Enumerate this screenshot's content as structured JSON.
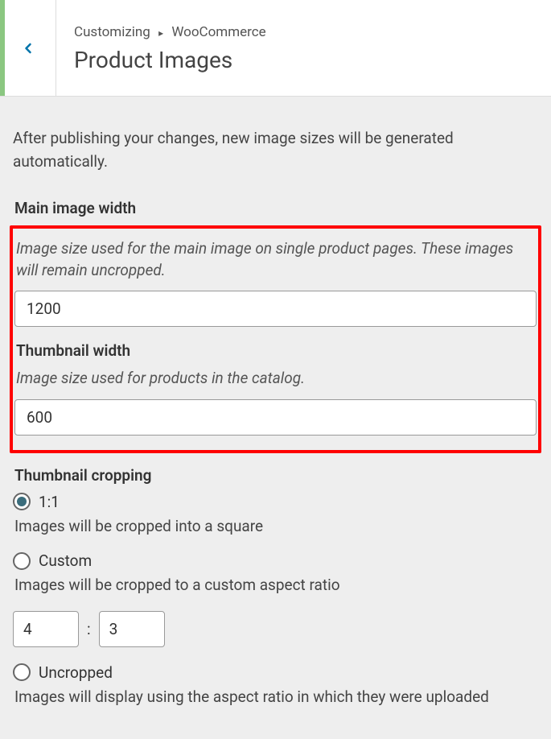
{
  "header": {
    "breadcrumb_prefix": "Customizing",
    "breadcrumb_section": "WooCommerce",
    "title": "Product Images"
  },
  "intro": "After publishing your changes, new image sizes will be generated automatically.",
  "main_image": {
    "label": "Main image width",
    "description": "Image size used for the main image on single product pages. These images will remain uncropped.",
    "value": "1200"
  },
  "thumbnail": {
    "label": "Thumbnail width",
    "description": "Image size used for products in the catalog.",
    "value": "600"
  },
  "cropping": {
    "label": "Thumbnail cropping",
    "options": {
      "one_one": {
        "label": "1:1",
        "description": "Images will be cropped into a square"
      },
      "custom": {
        "label": "Custom",
        "description": "Images will be cropped to a custom aspect ratio",
        "ratio_w": "4",
        "ratio_h": "3",
        "ratio_sep": ":"
      },
      "uncropped": {
        "label": "Uncropped",
        "description": "Images will display using the aspect ratio in which they were uploaded"
      }
    }
  }
}
